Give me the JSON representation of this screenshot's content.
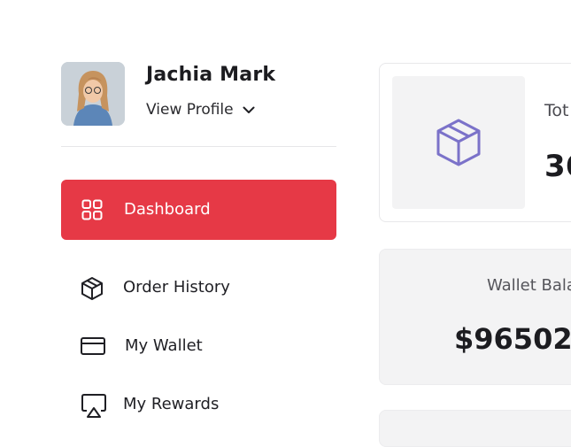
{
  "profile": {
    "name": "Jachia Mark",
    "view_profile_label": "View Profile"
  },
  "nav": {
    "dashboard": "Dashboard",
    "order_history": "Order History",
    "my_wallet": "My Wallet",
    "my_rewards": "My Rewards"
  },
  "stats": {
    "total_label": "Tot",
    "total_value": "36",
    "wallet_label": "Wallet Bala",
    "wallet_value": "$96502"
  },
  "colors": {
    "accent": "#e63946",
    "box_icon": "#7b72c9"
  },
  "icons": {
    "dashboard": "grid-icon",
    "order_history": "package-icon",
    "my_wallet": "credit-card-icon",
    "my_rewards": "airplay-icon",
    "orders_card": "package-icon",
    "profile_toggle": "chevron-down-icon"
  }
}
